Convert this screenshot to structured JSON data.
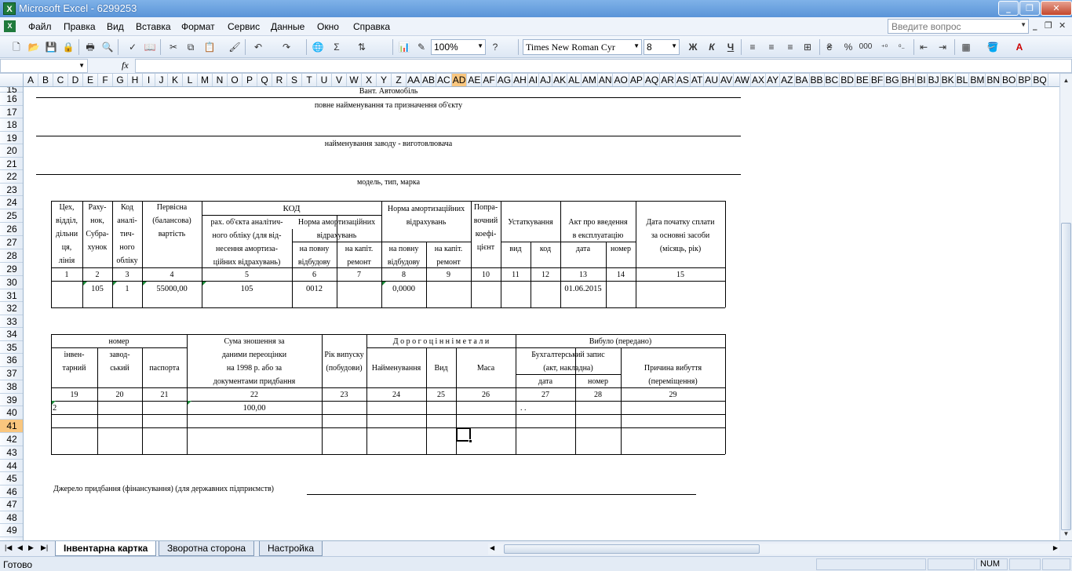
{
  "window": {
    "title": "Microsoft Excel - 6299253"
  },
  "menu": {
    "items": [
      "Файл",
      "Правка",
      "Вид",
      "Вставка",
      "Формат",
      "Сервис",
      "Данные",
      "Окно",
      "Справка"
    ],
    "help_placeholder": "Введите вопрос"
  },
  "toolbar": {
    "zoom": "100%",
    "font": "Times New Roman Cyr",
    "size": "8",
    "bold": "Ж",
    "italic": "К",
    "underline": "Ч",
    "percent": "%",
    "thousands": "000",
    "icons": [
      "new-icon",
      "open-icon",
      "save-icon",
      "permission-icon",
      "print-icon",
      "print-preview-icon",
      "spelling-icon",
      "research-icon",
      "cut-icon",
      "copy-icon",
      "paste-icon",
      "format-painter-icon",
      "undo-icon",
      "redo-icon",
      "hyperlink-icon",
      "autosum-icon",
      "sort-icon",
      "chart-icon",
      "drawing-icon",
      "help-icon"
    ]
  },
  "formula_bar": {
    "name_box": "",
    "fx": "fx"
  },
  "columns": [
    "A",
    "B",
    "C",
    "D",
    "E",
    "F",
    "G",
    "H",
    "I",
    "J",
    "K",
    "L",
    "M",
    "N",
    "O",
    "P",
    "Q",
    "R",
    "S",
    "T",
    "U",
    "V",
    "W",
    "X",
    "Y",
    "Z",
    "AA",
    "AB",
    "AC",
    "AD",
    "AE",
    "AF",
    "AG",
    "AH",
    "AI",
    "AJ",
    "AK",
    "AL",
    "AM",
    "AN",
    "AO",
    "AP",
    "AQ",
    "AR",
    "AS",
    "AT",
    "AU",
    "AV",
    "AW",
    "AX",
    "AY",
    "AZ",
    "BA",
    "BB",
    "BC",
    "BD",
    "BE",
    "BF",
    "BG",
    "BH",
    "BI",
    "BJ",
    "BK",
    "BL",
    "BM",
    "BN",
    "BO",
    "BP",
    "BQ"
  ],
  "active_column": "AD",
  "rows": [
    "15",
    "16",
    "17",
    "18",
    "19",
    "20",
    "21",
    "22",
    "23",
    "24",
    "25",
    "26",
    "27",
    "28",
    "29",
    "30",
    "31",
    "32",
    "33",
    "34",
    "35",
    "36",
    "37",
    "38",
    "39",
    "40",
    "41",
    "42",
    "43",
    "44",
    "45",
    "46",
    "47",
    "48",
    "49"
  ],
  "active_row": "41",
  "sheet": {
    "vehicle": "Вант. Автомобіль",
    "caption_name": "повне найменування та призначення  об'єкту",
    "caption_plant": "найменування заводу - виготовлювача",
    "caption_model": "модель, тип, марка",
    "table1": {
      "h_shop": [
        "Цех,",
        "відділ,",
        "дільни",
        "ця,",
        "лінія"
      ],
      "h_account": [
        "Раху-",
        "нок,",
        "Субра-",
        "хунок"
      ],
      "h_code": [
        "Код",
        "аналі-",
        "тич-",
        "ного",
        "обліку"
      ],
      "h_initial": [
        "Первісна",
        "(балансова)",
        "вартість"
      ],
      "h_kod": "КОД",
      "h_rah": [
        "рах. об'єкта аналітич-",
        "ного обліку (для від-",
        "несення амортиза-",
        "ційних відрахувань)"
      ],
      "h_norm1": [
        "Норма амортизаційних",
        "відрахувань"
      ],
      "h_norm2": [
        "Норма амортизаційних",
        "відрахувань"
      ],
      "h_full": [
        "на повну",
        "відбудову"
      ],
      "h_cap": [
        "на капіт.",
        "ремонт"
      ],
      "h_coef": [
        "Попра-",
        "вочний",
        "коефі-",
        "цієнт"
      ],
      "h_equip": "Устаткування",
      "h_kind": "вид",
      "h_kod2": "код",
      "h_act": [
        "Акт про введення",
        "в експлуатацію"
      ],
      "h_date": "дата",
      "h_number": "номер",
      "h_start": [
        "Дата початку сплати",
        "за основні засоби",
        "(місяць, рік)"
      ],
      "nums": [
        "1",
        "2",
        "3",
        "4",
        "5",
        "6",
        "7",
        "8",
        "9",
        "10",
        "11",
        "12",
        "13",
        "14",
        "15"
      ],
      "values": {
        "account": "105",
        "code": "1",
        "initial": "55000,00",
        "rah": "105",
        "full1": "0012",
        "full2": "0,0000",
        "date": "01.06.2015"
      }
    },
    "table2": {
      "h_number": "номер",
      "h_inv": [
        "інвен-",
        "тарний"
      ],
      "h_factory": [
        "завод-",
        "ський"
      ],
      "h_passport": "паспорта",
      "h_sum": [
        "Сума зношення за",
        "даними переоцінки",
        "на 1998 р. або за",
        "документами придбання"
      ],
      "h_year": [
        "Рік випуску",
        "(побудови)"
      ],
      "h_metals": "Д о р о г о ц і н н і   м е т а л и",
      "h_name": "Найменування",
      "h_kind": "Вид",
      "h_mass": "Маса",
      "h_retired": "Вибуло  (передано)",
      "h_acc": [
        "Бухгалтерський запис",
        "(акт, накладна)"
      ],
      "h_date": "дата",
      "h_num": "номер",
      "h_reason": [
        "Причина вибуття",
        "(переміщення)"
      ],
      "nums": [
        "19",
        "20",
        "21",
        "22",
        "23",
        "24",
        "25",
        "26",
        "27",
        "28",
        "29"
      ],
      "values": {
        "inv": "2",
        "sum": "100,00",
        "dots": ". ."
      }
    },
    "source_label": "Джерело придбання (фінансування) (для державних підприємств)"
  },
  "tabs": [
    "Інвентарна картка",
    "Зворотна  сторона",
    "Настройка"
  ],
  "status": {
    "text": "Готово",
    "num": "NUM"
  }
}
